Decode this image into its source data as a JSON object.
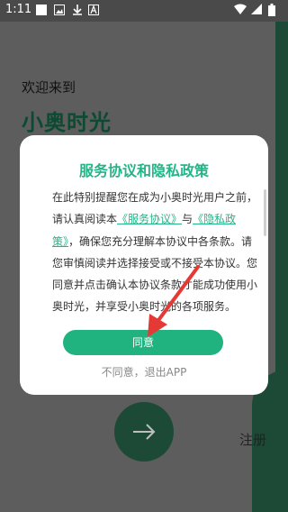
{
  "status_bar": {
    "time": "1:11",
    "icons": [
      "square-icon",
      "image-icon",
      "download-icon",
      "text-a-icon",
      "wifi-icon",
      "signal-icon",
      "battery-icon"
    ]
  },
  "background": {
    "welcome": "欢迎来到",
    "app_name": "小奥时光",
    "register": "注册",
    "next_icon": "arrow-right-icon"
  },
  "dialog": {
    "title": "服务协议和隐私政策",
    "body_before_link1": "在此特别提醒您在成为小奥时光用户之前，请认真阅读本",
    "link1": "《服务协议》",
    "between_links": "与",
    "link2": "《隐私政策》",
    "body_after_link2": "，确保您充分理解本协议中各条款。请您审慎阅读并选择接受或不接受本协议。您同意并点击确认本协议条款才能成功使用小奥时光，并享受小奥时光的各项服务。",
    "agree_label": "同意",
    "disagree_label": "不同意，退出APP"
  },
  "colors": {
    "accent": "#21b37f",
    "dark_green": "#1c4a36",
    "annotation": "#e53935"
  }
}
